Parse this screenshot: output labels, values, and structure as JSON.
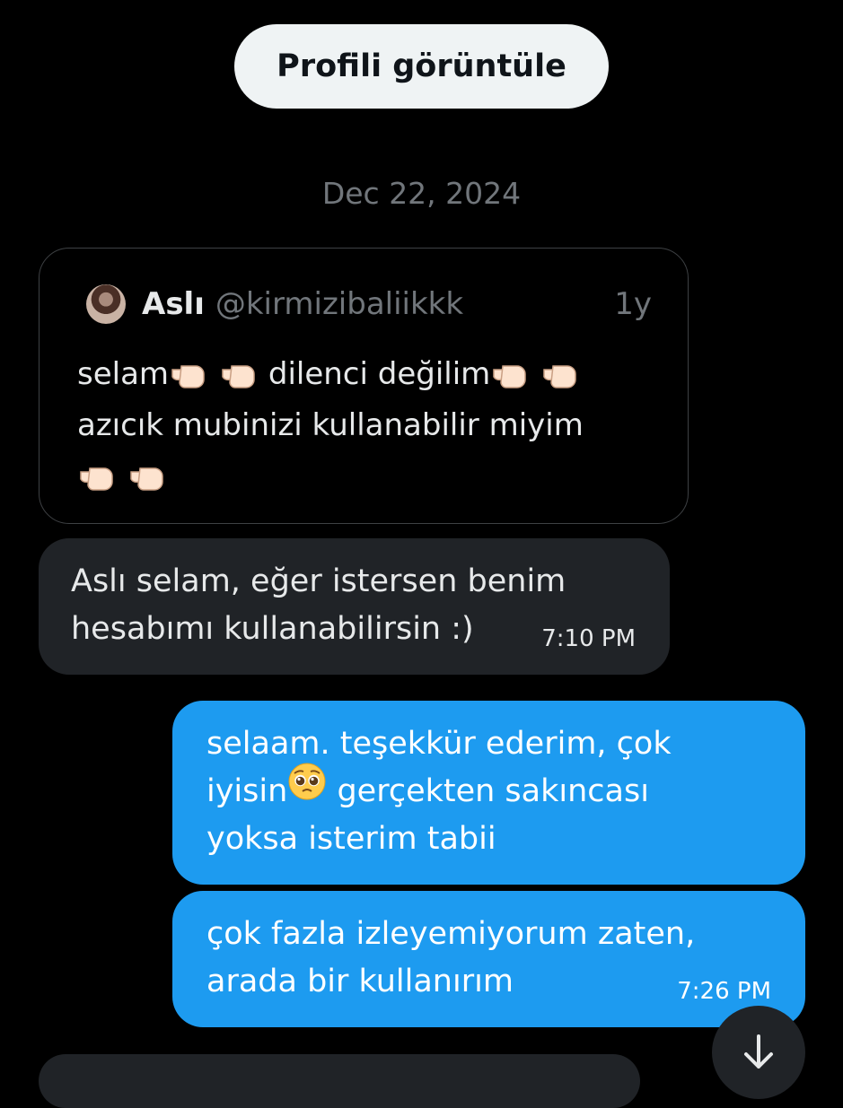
{
  "profile_button": {
    "label": "Profili görüntüle"
  },
  "date_separator": "Dec 22, 2024",
  "quoted_post": {
    "author_name": "Aslı",
    "author_handle": "@kirmizibaliikkk",
    "relative_time": "1y",
    "text_parts": [
      "selam",
      "dilenci değilim",
      "azıcık mubinizi kullanabilir miyim"
    ],
    "emoji": "backhand-index-pointing-right x2"
  },
  "messages": [
    {
      "direction": "incoming",
      "lines": [
        "Aslı selam, eğer istersen benim",
        "hesabımı kullanabilirsin :)"
      ],
      "time": "7:10 PM"
    },
    {
      "direction": "outgoing",
      "lines": [
        "selaam. teşekkür ederim, çok",
        "iyisin",
        "gerçekten sakıncası",
        "yoksa isterim tabii"
      ],
      "emoji": "pleading-face"
    },
    {
      "direction": "outgoing",
      "lines": [
        "çok fazla izleyemiyorum zaten,",
        "arada bir kullanırım"
      ],
      "time": "7:26 PM"
    }
  ],
  "icons": {
    "scroll_down": "arrow-down-icon",
    "avatar": "avatar"
  },
  "colors": {
    "background": "#000000",
    "outgoing_bubble": "#1d9bf0",
    "incoming_bubble": "#202327",
    "muted_text": "#71767b",
    "primary_text": "#e7e9ea"
  }
}
